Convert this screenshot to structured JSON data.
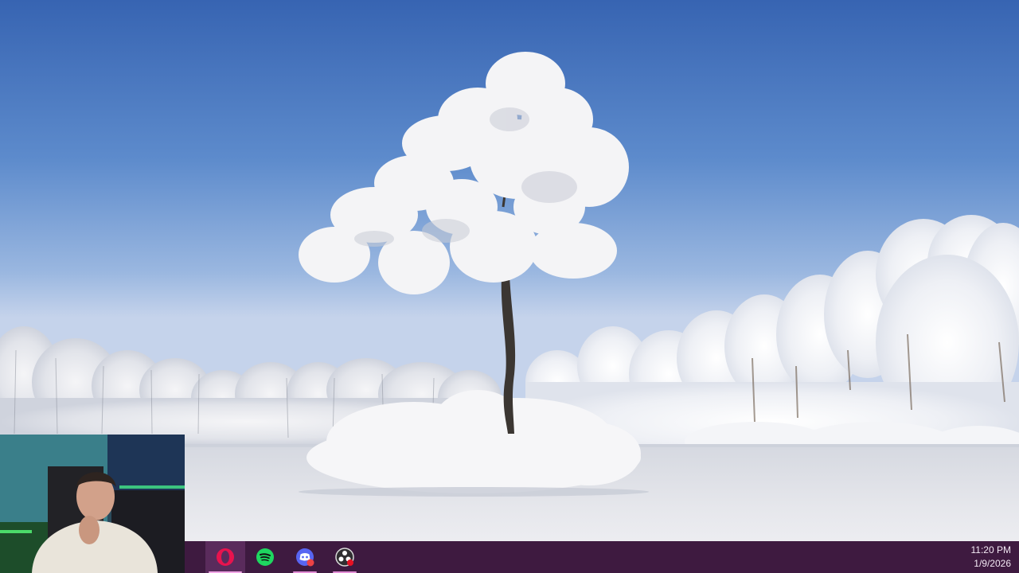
{
  "taskbar": {
    "apps": [
      {
        "name": "Opera GX",
        "icon": "opera-icon",
        "active": true
      },
      {
        "name": "Spotify",
        "icon": "spotify-icon",
        "active": false
      },
      {
        "name": "Discord",
        "icon": "discord-icon",
        "active": false
      },
      {
        "name": "OBS Studio",
        "icon": "obs-icon",
        "active": false
      }
    ],
    "accent_color": "#3e1a40",
    "indicator_color": "#e38ed6"
  },
  "clock": {
    "time": "11:20 PM",
    "date": "1/9/2026"
  }
}
